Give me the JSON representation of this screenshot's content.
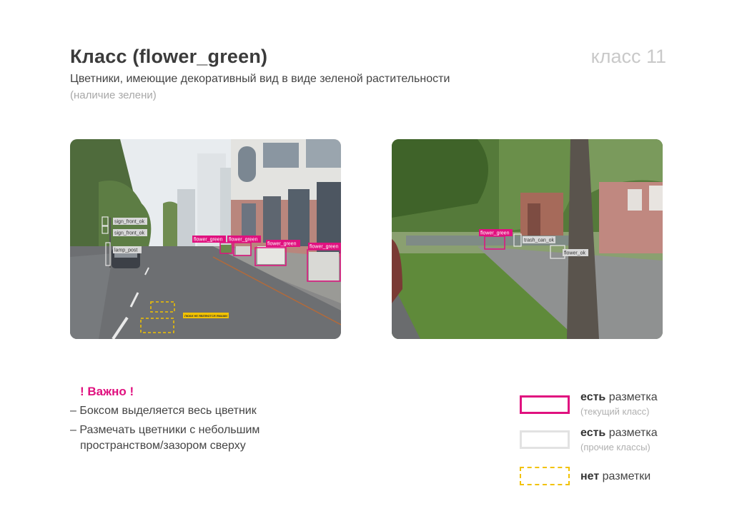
{
  "header": {
    "title": "Класс (flower_green)",
    "class_number": "класс 11",
    "subtitle": "Цветники, имеющие декоративный вид в виде зеленой растительности",
    "subnote": "(наличие зелени)"
  },
  "photo_left": {
    "labels": {
      "sign1": "sign_front_ok",
      "sign2": "sign_front_ok",
      "lamp": "lamp_post",
      "fg1": "flower_green",
      "fg2": "flower_green",
      "fg3": "flower_green",
      "fg4": "flower_green",
      "yellow_note": "ЛЮКИ НЕ ЯВЛЯЮТСЯ ЯМАМИ"
    }
  },
  "photo_right": {
    "labels": {
      "fg": "flower_green",
      "trash": "trash_can_ok",
      "flower_ok": "flower_ok"
    }
  },
  "important": {
    "title": "! Важно !",
    "rule1": "–  Боксом выделяется весь цветник",
    "rule2": "–  Размечать цветники с небольшим",
    "rule2_cont": "пространством/зазором сверху"
  },
  "legend": {
    "item1_bold": "есть",
    "item1_rest": " разметка",
    "item1_sub": "(текущий класс)",
    "item2_bold": "есть",
    "item2_rest": " разметка",
    "item2_sub": "(прочие классы)",
    "item3_bold": "нет",
    "item3_rest": " разметки"
  },
  "colors": {
    "accent_pink": "#e0117f",
    "other_grey": "#e2e2e2",
    "missing_yellow": "#f2c200"
  }
}
